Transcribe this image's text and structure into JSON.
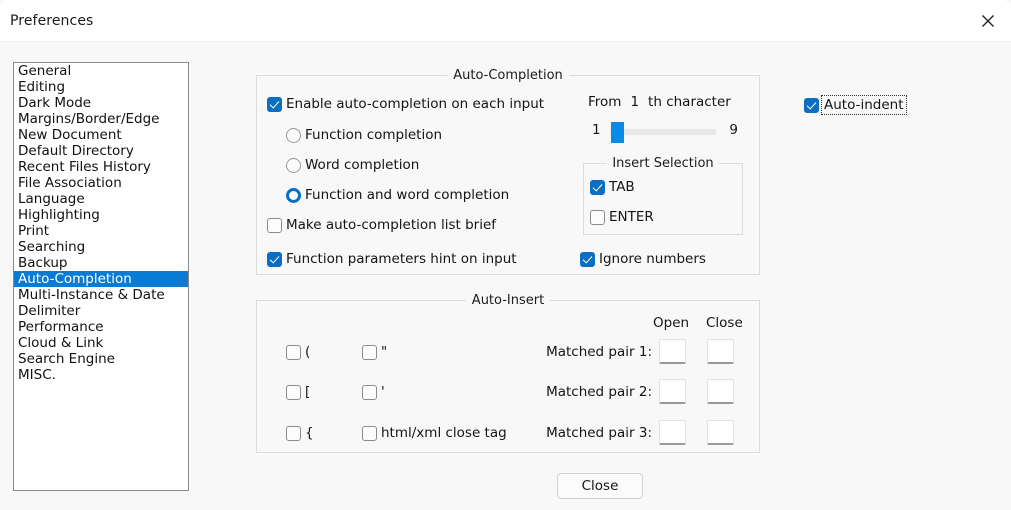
{
  "window": {
    "title": "Preferences",
    "close_icon": "close-x-icon"
  },
  "sidebar": {
    "items": [
      {
        "label": "General",
        "selected": false
      },
      {
        "label": "Editing",
        "selected": false
      },
      {
        "label": "Dark Mode",
        "selected": false
      },
      {
        "label": "Margins/Border/Edge",
        "selected": false
      },
      {
        "label": "New Document",
        "selected": false
      },
      {
        "label": "Default Directory",
        "selected": false
      },
      {
        "label": "Recent Files History",
        "selected": false
      },
      {
        "label": "File Association",
        "selected": false
      },
      {
        "label": "Language",
        "selected": false
      },
      {
        "label": "Highlighting",
        "selected": false
      },
      {
        "label": "Print",
        "selected": false
      },
      {
        "label": "Searching",
        "selected": false
      },
      {
        "label": "Backup",
        "selected": false
      },
      {
        "label": "Auto-Completion",
        "selected": true
      },
      {
        "label": "Multi-Instance & Date",
        "selected": false
      },
      {
        "label": "Delimiter",
        "selected": false
      },
      {
        "label": "Performance",
        "selected": false
      },
      {
        "label": "Cloud & Link",
        "selected": false
      },
      {
        "label": "Search Engine",
        "selected": false
      },
      {
        "label": "MISC.",
        "selected": false
      }
    ]
  },
  "auto_completion": {
    "group_title": "Auto-Completion",
    "enable_label": "Enable auto-completion on each input",
    "enable_checked": true,
    "radio_function": "Function completion",
    "radio_word": "Word completion",
    "radio_function_and_word": "Function and word completion",
    "selected_radio": "Function and word completion",
    "brief_label": "Make auto-completion list brief",
    "brief_checked": false,
    "hint_label": "Function parameters hint on input",
    "hint_checked": true,
    "from_prefix": "From",
    "from_value": "1",
    "from_suffix": "th character",
    "slider_min": "1",
    "slider_max": "9",
    "slider_value": "1",
    "insert_selection": {
      "group_title": "Insert Selection",
      "tab_label": "TAB",
      "tab_checked": true,
      "enter_label": "ENTER",
      "enter_checked": false
    },
    "ignore_numbers_label": "Ignore numbers",
    "ignore_numbers_checked": true
  },
  "auto_indent": {
    "label": "Auto-indent",
    "checked": true,
    "focused": true
  },
  "auto_insert": {
    "group_title": "Auto-Insert",
    "col_open": "Open",
    "col_close": "Close",
    "left_items": [
      {
        "label": "(",
        "checked": false
      },
      {
        "label": "[",
        "checked": false
      },
      {
        "label": "{",
        "checked": false
      }
    ],
    "mid_items": [
      {
        "label": "\"",
        "checked": false
      },
      {
        "label": "'",
        "checked": false
      },
      {
        "label": "html/xml close tag",
        "checked": false
      }
    ],
    "matched_pairs": [
      {
        "label": "Matched pair 1:",
        "open_value": "",
        "close_value": ""
      },
      {
        "label": "Matched pair 2:",
        "open_value": "",
        "close_value": ""
      },
      {
        "label": "Matched pair 3:",
        "open_value": "",
        "close_value": ""
      }
    ]
  },
  "footer": {
    "close_label": "Close"
  },
  "colors": {
    "accent": "#0a6fc2",
    "selection": "#0a7bd4",
    "slider_thumb": "#0a8ae8",
    "window_bg": "#f8f8f8",
    "titlebar_bg": "#ffffff"
  }
}
